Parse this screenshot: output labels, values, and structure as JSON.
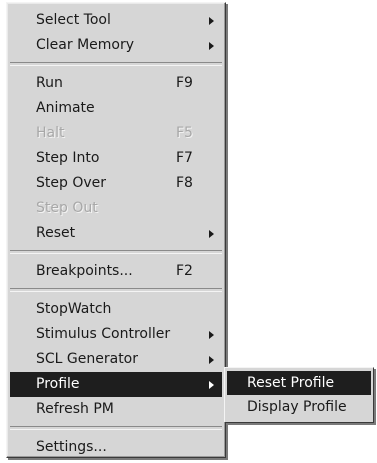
{
  "menu": {
    "groups": [
      [
        {
          "label": "Select Tool",
          "submenu": true
        },
        {
          "label": "Clear Memory",
          "submenu": true
        }
      ],
      [
        {
          "label": "Run",
          "shortcut": "F9"
        },
        {
          "label": "Animate"
        },
        {
          "label": "Halt",
          "shortcut": "F5",
          "disabled": true
        },
        {
          "label": "Step Into",
          "shortcut": "F7"
        },
        {
          "label": "Step Over",
          "shortcut": "F8"
        },
        {
          "label": "Step Out",
          "disabled": true
        },
        {
          "label": "Reset",
          "submenu": true
        }
      ],
      [
        {
          "label": "Breakpoints...",
          "shortcut": "F2"
        }
      ],
      [
        {
          "label": "StopWatch"
        },
        {
          "label": "Stimulus Controller",
          "submenu": true
        },
        {
          "label": "SCL Generator",
          "submenu": true
        },
        {
          "label": "Profile",
          "submenu": true,
          "highlighted": true
        },
        {
          "label": "Refresh PM"
        }
      ],
      [
        {
          "label": "Settings..."
        }
      ]
    ]
  },
  "submenu": {
    "items": [
      {
        "label": "Reset Profile",
        "highlighted": true
      },
      {
        "label": "Display Profile"
      }
    ]
  }
}
